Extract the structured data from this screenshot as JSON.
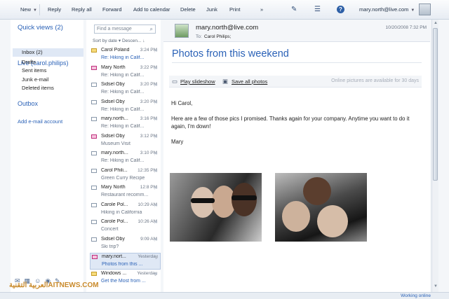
{
  "toolbar": {
    "new": "New",
    "reply": "Reply",
    "reply_all": "Reply all",
    "forward": "Forward",
    "add_to_calendar": "Add to calendar",
    "delete": "Delete",
    "junk": "Junk",
    "print": "Print",
    "more": "»",
    "account": "mary.north@live.com"
  },
  "nav": {
    "quick_views": "Quick views (2)",
    "account": "Live (carol.philips)",
    "folders": [
      {
        "label": "Inbox (2)"
      },
      {
        "label": "Drafts"
      },
      {
        "label": "Sent items"
      },
      {
        "label": "Junk e-mail"
      },
      {
        "label": "Deleted items"
      }
    ],
    "outbox": "Outbox",
    "add_account": "Add e-mail account",
    "bottom_icons": [
      "mail-icon",
      "calendar-icon",
      "contacts-icon",
      "feeds-icon",
      "newsgroups-icon"
    ]
  },
  "list": {
    "search_placeholder": "Find a message",
    "sort_label": "Sort by date",
    "sort_order": "Descen...",
    "messages": [
      {
        "from": "Carol Poland",
        "time": "3:24 PM",
        "subject": "Re: Hiking in Calif...",
        "icon": "yellow",
        "unread": true
      },
      {
        "from": "Mary North",
        "time": "3:22 PM",
        "subject": "Re: Hiking in Calif...",
        "icon": "pink",
        "unread": false
      },
      {
        "from": "Sidsel Oby",
        "time": "3:20 PM",
        "subject": "Re: Hiking in Calif...",
        "icon": "plain",
        "unread": false
      },
      {
        "from": "Sidsel Oby",
        "time": "3:20 PM",
        "subject": "Re: Hiking in Calif...",
        "icon": "plain",
        "unread": false
      },
      {
        "from": "mary.north...",
        "time": "3:16 PM",
        "subject": "Re: Hiking in Calif...",
        "icon": "plain",
        "unread": false
      },
      {
        "from": "Sidsel Oby",
        "time": "3:12 PM",
        "subject": "Museum Visit",
        "icon": "pink",
        "unread": false
      },
      {
        "from": "mary.north...",
        "time": "3:10 PM",
        "subject": "Re: Hiking in Calif...",
        "icon": "plain",
        "unread": false
      },
      {
        "from": "Carol Phili...",
        "time": "12:35 PM",
        "subject": "Green Curry Recipe",
        "icon": "plain",
        "unread": false
      },
      {
        "from": "Mary North",
        "time": "12:8 PM",
        "subject": "Restaurant recomm...",
        "icon": "plain",
        "unread": false
      },
      {
        "from": "Carole Pol...",
        "time": "10:29 AM",
        "subject": "Hiking in California",
        "icon": "plain",
        "unread": false
      },
      {
        "from": "Carole Pol...",
        "time": "10:26 AM",
        "subject": "Concert",
        "icon": "plain",
        "unread": false
      },
      {
        "from": "Sidsel Oby",
        "time": "9:09 AM",
        "subject": "Ski trip?",
        "icon": "plain",
        "unread": false
      },
      {
        "from": "mary.nort...",
        "time": "Yesterday",
        "subject": "Photos from this ...",
        "icon": "pink",
        "unread": true
      },
      {
        "from": "Windows ...",
        "time": "Yesterday",
        "subject": "Get the Most from ...",
        "icon": "yellow",
        "unread": true
      }
    ]
  },
  "reading": {
    "sender": "mary.north@live.com",
    "to_label": "To:",
    "to_value": "Carol Philips;",
    "date": "10/20/2008 7:32 PM",
    "subject": "Photos from this weekend",
    "play_slideshow": "Play slideshow",
    "save_all_photos": "Save all photos",
    "availability": "Online pictures are available for 30 days",
    "body": {
      "greeting": "Hi Carol,",
      "line1": "Here are a few of those pics I promised. Thanks again for your company. Anytime you want to do it",
      "line2": "again, I'm down!",
      "signature": "Mary"
    }
  },
  "status": {
    "text": "Working online"
  },
  "watermark": "العربية التقنيةAITNEWS.COM"
}
